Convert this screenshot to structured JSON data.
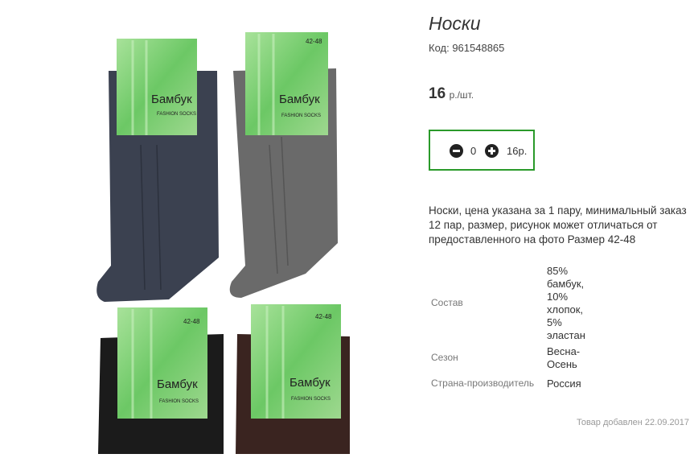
{
  "product": {
    "title": "Носки",
    "code": "Код: 961548865",
    "price_value": "16",
    "price_unit": "р./шт."
  },
  "cart": {
    "quantity": "0",
    "total": "16р."
  },
  "description": "Носки, цена указана за 1 пару, минимальный заказ 12 пар, размер, рисунок может отличаться от предоставленного на фото Размер 42-48",
  "properties": [
    {
      "label": "Состав",
      "value": "85% бамбук, 10% хлопок, 5% эластан"
    },
    {
      "label": "Сезон",
      "value": "Весна-Осень"
    },
    {
      "label": "Страна-производитель",
      "value": "Россия"
    }
  ],
  "added_date": "Товар добавлен 22.09.2017",
  "photo": {
    "brand_label": "Бамбук",
    "sub_label": "FASHION SOCKS",
    "size_label": "42-48",
    "colors": {
      "tag_green": "#7ed07a",
      "navy": "#3b4150",
      "grey": "#6a6a6a",
      "black": "#1b1b1b",
      "brown": "#3a2420"
    }
  }
}
